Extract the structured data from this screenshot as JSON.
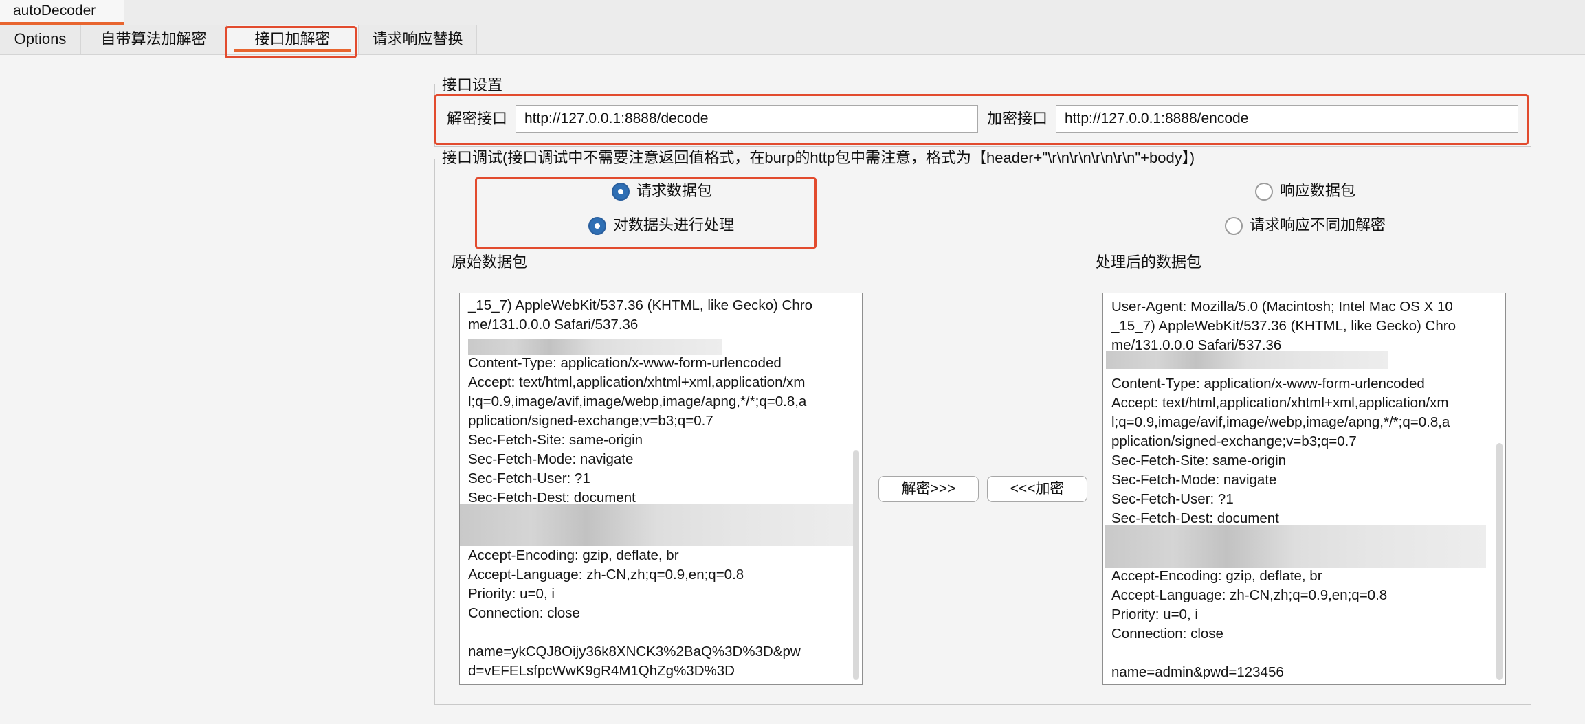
{
  "app": {
    "tab_title": "autoDecoder"
  },
  "subtabs": [
    {
      "label": "Options"
    },
    {
      "label": "自带算法加解密"
    },
    {
      "label": "接口加解密"
    },
    {
      "label": "请求响应替换"
    }
  ],
  "interface_settings": {
    "legend": "接口设置",
    "decode_label": "解密接口",
    "decode_value": "http://127.0.0.1:8888/decode",
    "encode_label": "加密接口",
    "encode_value": "http://127.0.0.1:8888/encode"
  },
  "debug": {
    "legend": "接口调试(接口调试中不需要注意返回值格式，在burp的http包中需注意，格式为【header+\"\\r\\n\\r\\n\\r\\n\\r\\n\"+body】)",
    "radio_request": "请求数据包",
    "radio_header": "对数据头进行处理",
    "radio_response": "响应数据包",
    "radio_diff": "请求响应不同加解密",
    "original_label": "原始数据包",
    "processed_label": "处理后的数据包",
    "decrypt_button": "解密>>>",
    "encrypt_button": "<<<加密",
    "original_lines": [
      "_15_7) AppleWebKit/537.36 (KHTML, like Gecko) Chro",
      "me/131.0.0.0 Safari/537.36",
      "",
      "Content-Type: application/x-www-form-urlencoded",
      "Accept: text/html,application/xhtml+xml,application/xm",
      "l;q=0.9,image/avif,image/webp,image/apng,*/*;q=0.8,a",
      "pplication/signed-exchange;v=b3;q=0.7",
      "Sec-Fetch-Site: same-origin",
      "Sec-Fetch-Mode: navigate",
      "Sec-Fetch-User: ?1",
      "Sec-Fetch-Dest: document",
      "",
      "Accept-Encoding: gzip, deflate, br",
      "Accept-Language: zh-CN,zh;q=0.9,en;q=0.8",
      "Priority: u=0, i",
      "Connection: close",
      "",
      "name=ykCQJ8Oijy36k8XNCK3%2BaQ%3D%3D&pw",
      "d=vEFELsfpcWwK9gR4M1QhZg%3D%3D"
    ],
    "processed_lines": [
      "User-Agent: Mozilla/5.0 (Macintosh; Intel Mac OS X 10",
      "_15_7) AppleWebKit/537.36 (KHTML, like Gecko) Chro",
      "me/131.0.0.0 Safari/537.36",
      "",
      "Content-Type: application/x-www-form-urlencoded",
      "Accept: text/html,application/xhtml+xml,application/xm",
      "l;q=0.9,image/avif,image/webp,image/apng,*/*;q=0.8,a",
      "pplication/signed-exchange;v=b3;q=0.7",
      "Sec-Fetch-Site: same-origin",
      "Sec-Fetch-Mode: navigate",
      "Sec-Fetch-User: ?1",
      "Sec-Fetch-Dest: document",
      "",
      "",
      "Accept-Encoding: gzip, deflate, br",
      "Accept-Language: zh-CN,zh;q=0.9,en;q=0.8",
      "Priority: u=0, i",
      "Connection: close",
      "",
      "name=admin&pwd=123456"
    ]
  }
}
